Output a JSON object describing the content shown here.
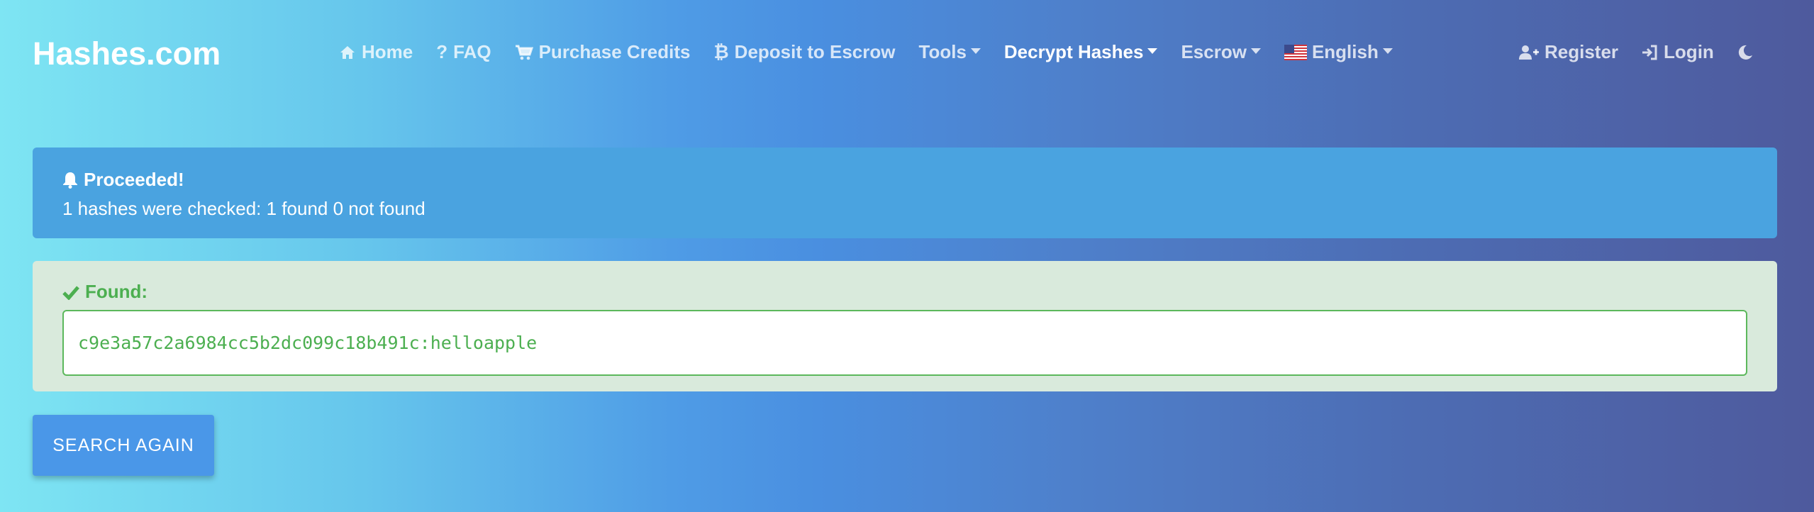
{
  "brand": "Hashes.com",
  "nav": {
    "items": [
      {
        "label": "Home",
        "icon": "home-icon"
      },
      {
        "label": "FAQ",
        "icon": "question-icon"
      },
      {
        "label": "Purchase Credits",
        "icon": "cart-icon"
      },
      {
        "label": "Deposit to Escrow",
        "icon": "bitcoin-icon"
      },
      {
        "label": "Tools",
        "icon": "caret-down-icon"
      },
      {
        "label": "Decrypt Hashes",
        "icon": "caret-down-icon"
      },
      {
        "label": "Escrow",
        "icon": "caret-down-icon"
      },
      {
        "label": "English",
        "icon": "us-flag-icon"
      }
    ],
    "right": [
      {
        "label": "Register",
        "icon": "user-plus-icon"
      },
      {
        "label": "Login",
        "icon": "sign-in-icon"
      },
      {
        "label": "",
        "icon": "moon-icon"
      }
    ]
  },
  "alert": {
    "title": "Proceeded!",
    "message": "1 hashes were checked: 1 found 0 not found",
    "icon": "bell-icon"
  },
  "result": {
    "label": "Found:",
    "icon": "check-icon",
    "value": "c9e3a57c2a6984cc5b2dc099c18b491c:helloapple"
  },
  "buttons": {
    "search_again": "SEARCH AGAIN"
  },
  "colors": {
    "info": "#4aa3e0",
    "success_bg": "#d9eadc",
    "success_text": "#4caf50",
    "button": "#4a97e8"
  }
}
